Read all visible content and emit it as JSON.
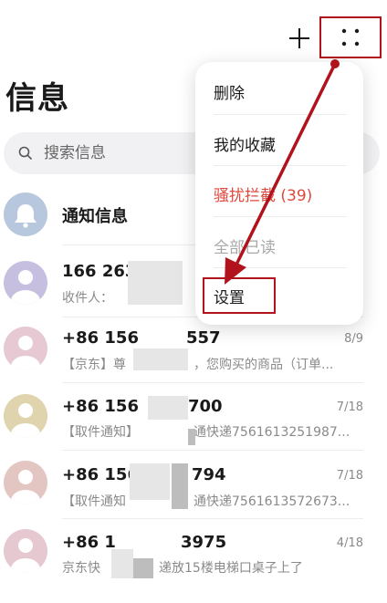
{
  "header": {
    "title": "信息",
    "add_icon": "plus-icon",
    "more_icon": "more-grid-icon"
  },
  "search": {
    "placeholder": "搜索信息"
  },
  "conversations": [
    {
      "title": "通知信息",
      "subtitle": "",
      "date": ""
    },
    {
      "title": "166 2637",
      "subtitle": "收件人：",
      "date": ""
    },
    {
      "title": "+86 156",
      "title_end": "557",
      "subtitle": "【京东】尊",
      "subtitle_end": "，您购买的商品（订单...",
      "date": "8/9"
    },
    {
      "title": "+86 156",
      "title_end": "700",
      "subtitle": "【取件通知】",
      "subtitle_end": "通快递7561613251987...",
      "date": "7/18"
    },
    {
      "title": "+86 156",
      "title_end": "794",
      "subtitle": "【取件通知",
      "subtitle_end": "通快递7561613572673...",
      "date": "7/18"
    },
    {
      "title": "+86 1",
      "title_end": "3975",
      "subtitle": "京东快",
      "subtitle_end": "递放15楼电梯口桌子上了",
      "date": "4/18"
    }
  ],
  "menu": {
    "items": [
      {
        "label": "删除",
        "color": "#1a1a1a"
      },
      {
        "label": "我的收藏",
        "color": "#1a1a1a"
      },
      {
        "label": "骚扰拦截 (39)",
        "color": "#e0483e"
      },
      {
        "label": "全部已读",
        "color": "#a8a8a8"
      },
      {
        "label": "设置",
        "color": "#1a1a1a"
      }
    ]
  },
  "colors": {
    "annotation": "#b1121b",
    "accent_red": "#e0483e"
  }
}
